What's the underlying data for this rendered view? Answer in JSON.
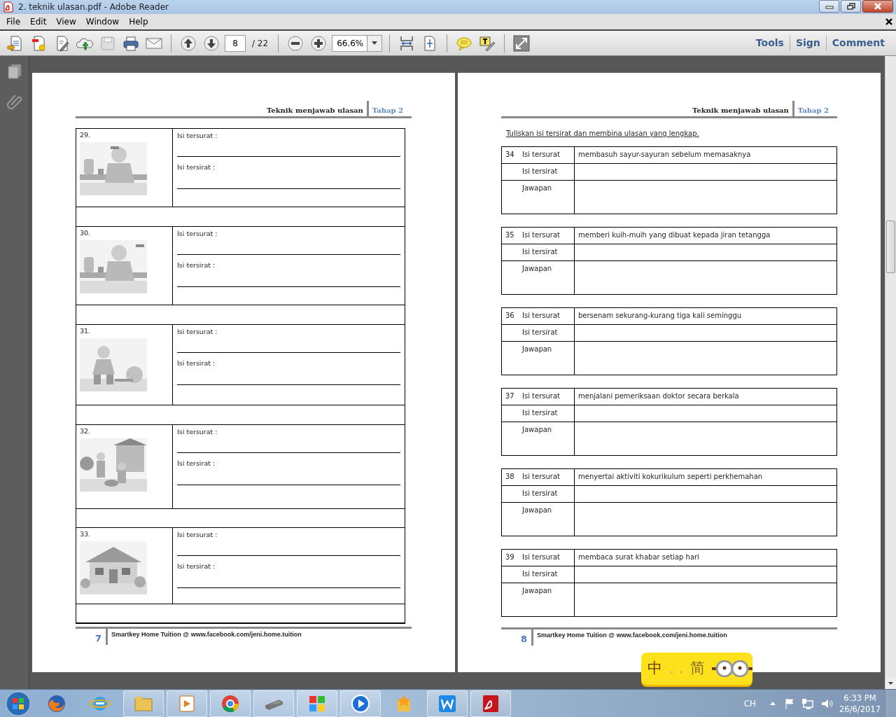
{
  "window": {
    "title": "2. teknik ulasan.pdf - Adobe Reader"
  },
  "menu": [
    "File",
    "Edit",
    "View",
    "Window",
    "Help"
  ],
  "toolbar": {
    "page": "8",
    "page_count": "/ 22",
    "zoom": "66.6%",
    "panes": [
      "Tools",
      "Sign",
      "Comment"
    ]
  },
  "left_page": {
    "header": {
      "title": "Teknik menjawab ulasan",
      "stage": "Tahap 2"
    },
    "questions": [
      {
        "number": "29.",
        "fields": [
          "Isi tersurat :",
          "Isi tersirat :"
        ]
      },
      {
        "number": "30.",
        "fields": [
          "Isi tersurat :",
          "Isi tersirat :"
        ]
      },
      {
        "number": "31.",
        "fields": [
          "Isi tersurat :",
          "Isi tersirat :"
        ]
      },
      {
        "number": "32.",
        "fields": [
          "Isi tersurat :",
          "Isi tersirat :"
        ]
      },
      {
        "number": "33.",
        "fields": [
          "Isi tersurat :",
          "Isi tersirat :"
        ]
      }
    ],
    "footer": {
      "number": "7",
      "text": "Smartkey Home Tuition @ www.facebook.com/jeni.home.tuition"
    }
  },
  "right_page": {
    "header": {
      "title": "Teknik menjawab ulasan",
      "stage": "Tahap 2"
    },
    "instruction": "Tuliskan isi tersirat dan membina ulasan yang lengkap.",
    "items": [
      {
        "number": "34",
        "rows": [
          {
            "label": "Isi tersurat",
            "value": "membasuh sayur-sayuran sebelum memasaknya"
          },
          {
            "label": "Isi tersirat"
          },
          {
            "label": "Jawapan"
          }
        ]
      },
      {
        "number": "35",
        "rows": [
          {
            "label": "Isi tersurat",
            "value": "memberi kuih-muih yang dibuat kepada jiran tetangga"
          },
          {
            "label": "Isi tersirat"
          },
          {
            "label": "Jawapan"
          }
        ]
      },
      {
        "number": "36",
        "rows": [
          {
            "label": "Isi tersurat",
            "value": "bersenam sekurang-kurang tiga kali seminggu"
          },
          {
            "label": "Isi tersirat"
          },
          {
            "label": "Jawapan"
          }
        ]
      },
      {
        "number": "37",
        "rows": [
          {
            "label": "Isi tersurat",
            "value": "menjalani pemeriksaan doktor secara berkala"
          },
          {
            "label": "Isi tersirat"
          },
          {
            "label": "Jawapan"
          }
        ]
      },
      {
        "number": "38",
        "rows": [
          {
            "label": "Isi tersurat",
            "value": "menyertai aktiviti kokurikulum seperti perkhemahan"
          },
          {
            "label": "Isi tersirat"
          },
          {
            "label": "Jawapan"
          }
        ]
      },
      {
        "number": "39",
        "rows": [
          {
            "label": "Isi tersurat",
            "value": "membaca surat khabar setiap hari"
          },
          {
            "label": "Isi tersirat"
          },
          {
            "label": "Jawapan"
          }
        ]
      }
    ],
    "footer": {
      "number": "8",
      "text": "Smartkey Home Tuition @ www.facebook.com/jeni.home.tuition"
    }
  },
  "ime": {
    "labels": [
      "中",
      "。,",
      "简"
    ]
  },
  "taskbar": {
    "apps": [
      {
        "running": false
      },
      {
        "running": false
      },
      {
        "running": true
      },
      {
        "running": true
      },
      {
        "running": true
      },
      {
        "running": true
      },
      {
        "running": true
      },
      {
        "running": true
      },
      {
        "running": false
      },
      {
        "running": true
      },
      {
        "running": true
      }
    ],
    "language": "CH",
    "time": "6:33 PM",
    "date": "26/6/2017"
  }
}
